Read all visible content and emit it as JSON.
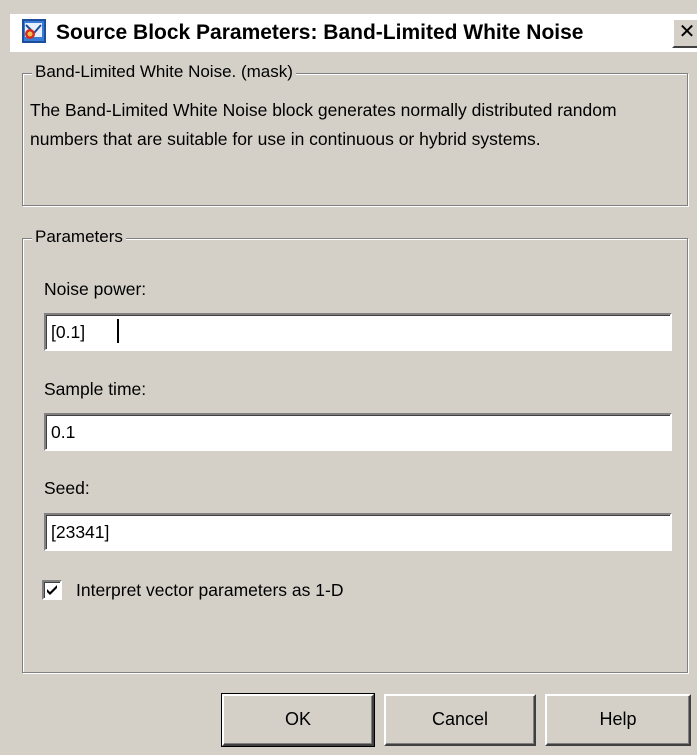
{
  "window": {
    "title": "Source Block Parameters: Band-Limited White Noise",
    "close_label": "✕"
  },
  "mask_group": {
    "label": "Band-Limited White Noise. (mask)",
    "description": "The Band-Limited White Noise block generates normally distributed random numbers that are suitable for use in continuous or hybrid systems."
  },
  "parameters_group": {
    "label": "Parameters",
    "fields": [
      {
        "label": "Noise power:",
        "value": "[0.1]"
      },
      {
        "label": "Sample time:",
        "value": "0.1"
      },
      {
        "label": "Seed:",
        "value": "[23341]"
      }
    ],
    "checkbox": {
      "label": "Interpret vector parameters as 1-D",
      "checked": true
    }
  },
  "buttons": {
    "ok_label": "OK",
    "cancel_label": "Cancel",
    "help_label": "Help"
  },
  "colors": {
    "window_bg": "#d4d0c8",
    "titlebar_bg": "#ffffff"
  }
}
